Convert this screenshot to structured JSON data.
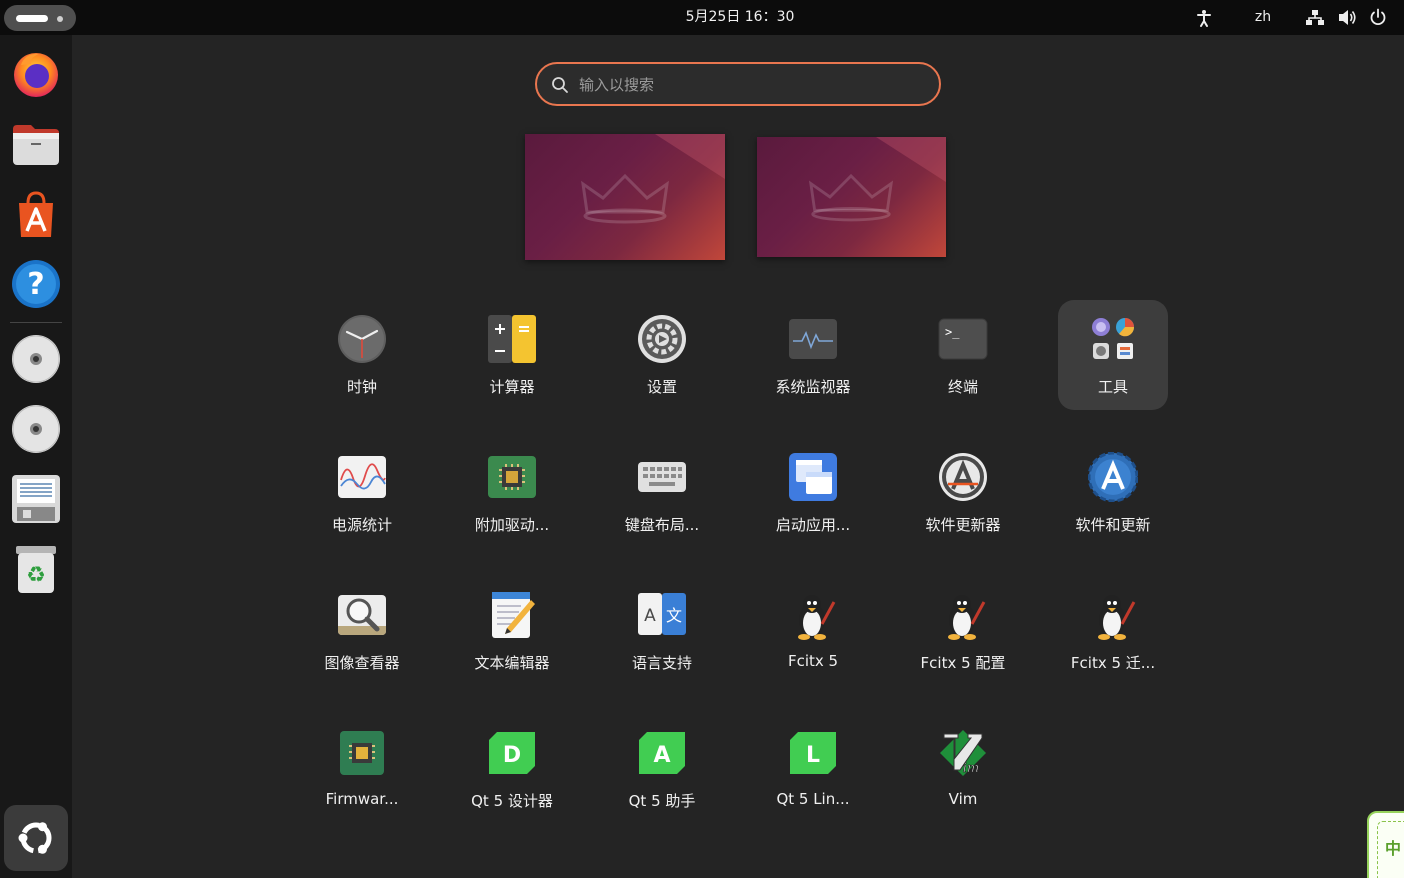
{
  "topbar": {
    "clock": "5月25日  16：30",
    "language": "zh",
    "icons": [
      "accessibility-icon",
      "network-icon",
      "volume-icon",
      "power-icon"
    ]
  },
  "dock": {
    "apps": [
      "firefox",
      "files",
      "app-center",
      "help",
      "optical-drive-1",
      "optical-drive-2",
      "floppy-drive",
      "trash"
    ],
    "show_apps": "show-apps-button"
  },
  "search": {
    "placeholder": "输入以搜索",
    "value": ""
  },
  "workspaces": [
    "workspace-1",
    "workspace-2"
  ],
  "apps": [
    {
      "label": "时钟",
      "icon": "clock-icon"
    },
    {
      "label": "计算器",
      "icon": "calculator-icon"
    },
    {
      "label": "设置",
      "icon": "settings-icon"
    },
    {
      "label": "系统监视器",
      "icon": "system-monitor-icon"
    },
    {
      "label": "终端",
      "icon": "terminal-icon"
    },
    {
      "label": "工具",
      "icon": "tools-folder-icon"
    },
    {
      "label": "电源统计",
      "icon": "power-statistics-icon"
    },
    {
      "label": "附加驱动...",
      "icon": "additional-drivers-icon"
    },
    {
      "label": "键盘布局...",
      "icon": "keyboard-layout-icon"
    },
    {
      "label": "启动应用...",
      "icon": "startup-applications-icon"
    },
    {
      "label": "软件更新器",
      "icon": "software-updater-icon"
    },
    {
      "label": "软件和更新",
      "icon": "software-sources-icon"
    },
    {
      "label": "图像查看器",
      "icon": "image-viewer-icon"
    },
    {
      "label": "文本编辑器",
      "icon": "text-editor-icon"
    },
    {
      "label": "语言支持",
      "icon": "language-support-icon"
    },
    {
      "label": "Fcitx 5",
      "icon": "fcitx-penguin-icon"
    },
    {
      "label": "Fcitx 5 配置",
      "icon": "fcitx-config-penguin-icon"
    },
    {
      "label": "Fcitx 5 迁...",
      "icon": "fcitx-migrator-penguin-icon"
    },
    {
      "label": "Firmwar...",
      "icon": "firmware-icon"
    },
    {
      "label": "Qt 5 设计器",
      "icon": "qt-designer-icon"
    },
    {
      "label": "Qt 5 助手",
      "icon": "qt-assistant-icon"
    },
    {
      "label": "Qt 5 Lin...",
      "icon": "qt-linguist-icon"
    },
    {
      "label": "Vim",
      "icon": "vim-icon"
    }
  ],
  "colors": {
    "accent": "#e9764f",
    "background": "#242424",
    "topbar": "#0c0c0c",
    "dock": "#181818"
  },
  "ime_tray": {
    "label": "中"
  }
}
